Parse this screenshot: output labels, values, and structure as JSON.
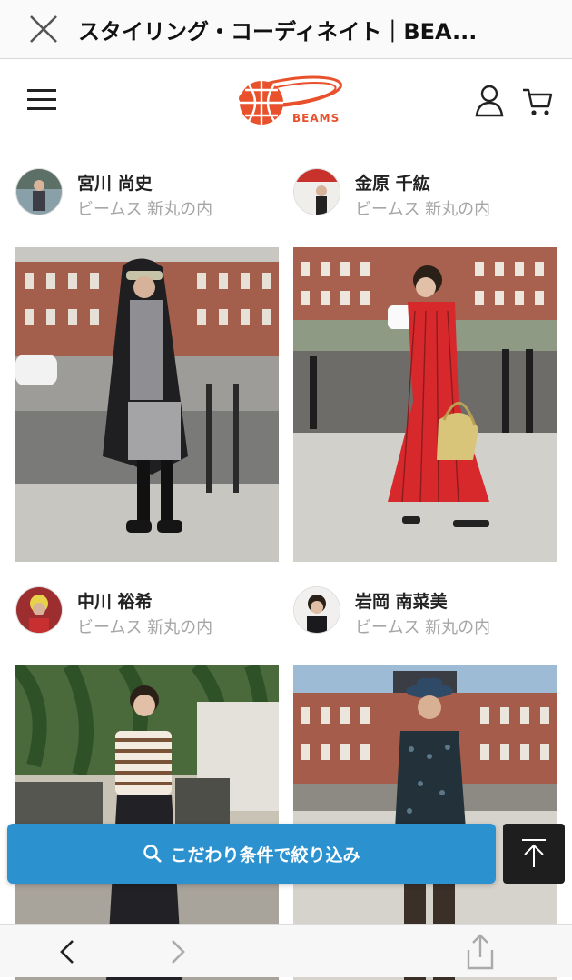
{
  "topbar": {
    "title": "スタイリング・コーディネイト｜BEA..."
  },
  "header": {
    "logo_text": "BEAMS"
  },
  "cards": [
    {
      "name": "宮川 尚史",
      "shop": "ビームス 新丸の内"
    },
    {
      "name": "金原 千紘",
      "shop": "ビームス 新丸の内"
    },
    {
      "name": "中川 裕希",
      "shop": "ビームス 新丸の内"
    },
    {
      "name": "岩岡 南菜美",
      "shop": "ビームス 新丸の内"
    }
  ],
  "filter": {
    "label": "こだわり条件で絞り込み"
  },
  "colors": {
    "accent": "#2b91cf",
    "brand": "#e8512b",
    "dark": "#1e1e1e"
  },
  "icons": [
    "close-icon",
    "hamburger-icon",
    "user-icon",
    "cart-icon",
    "search-icon",
    "arrow-up-icon",
    "chevron-left-icon",
    "chevron-right-icon",
    "share-icon"
  ]
}
